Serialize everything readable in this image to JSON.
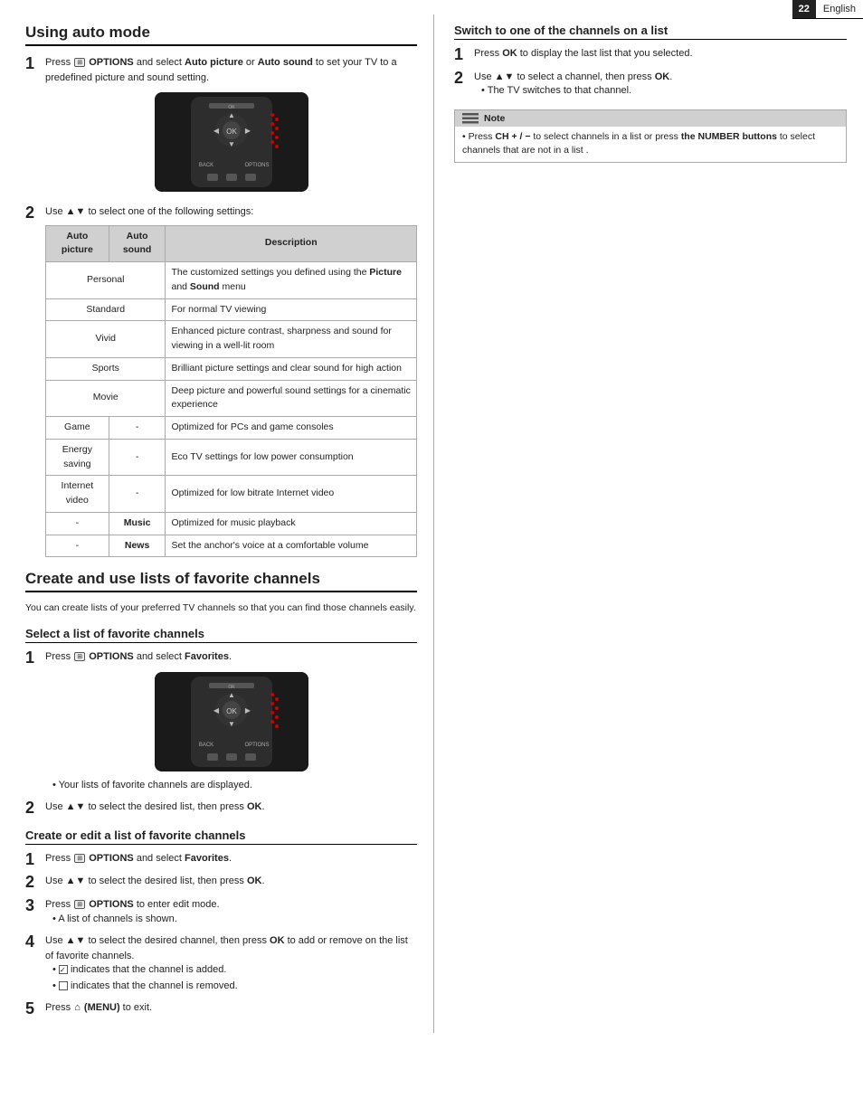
{
  "page": {
    "number": "22",
    "language": "English"
  },
  "left_column": {
    "section1": {
      "title": "Using auto mode",
      "step1": {
        "num": "1",
        "text_before": "Press ",
        "icon": "OPTIONS",
        "text_after": " OPTIONS and select ",
        "bold1": "Auto picture",
        "text_mid": " or ",
        "bold2": "Auto sound",
        "text_end": " to set your TV to a predefined picture and sound setting."
      },
      "step2": {
        "num": "2",
        "text": "Use ▲▼ to select one of the following settings:"
      },
      "table": {
        "headers": [
          "Auto picture",
          "Auto sound",
          "Description"
        ],
        "rows": [
          {
            "col1": "Personal",
            "col2": "",
            "merged12": true,
            "col3": "The customized settings you defined using the Picture and Sound menu"
          },
          {
            "col1": "Standard",
            "col2": "",
            "merged12": true,
            "col3": "For normal TV viewing"
          },
          {
            "col1": "Vivid",
            "col2": "",
            "merged12": true,
            "col3": "Enhanced picture contrast, sharpness and sound for viewing in a well-lit room"
          },
          {
            "col1": "Sports",
            "col2": "",
            "merged12": true,
            "col3": "Brilliant picture settings and clear sound for high action"
          },
          {
            "col1": "Movie",
            "col2": "",
            "merged12": true,
            "col3": "Deep picture and powerful sound settings for a cinematic experience"
          },
          {
            "col1": "Game",
            "col2": "-",
            "merged12": false,
            "col3": "Optimized for PCs and game consoles"
          },
          {
            "col1": "Energy saving",
            "col2": "-",
            "merged12": false,
            "col3": "Eco TV settings for low power consumption"
          },
          {
            "col1": "Internet video",
            "col2": "-",
            "merged12": false,
            "col3": "Optimized for low bitrate Internet video"
          },
          {
            "col1": "-",
            "col2": "Music",
            "merged12": false,
            "col3": "Optimized for music playback"
          },
          {
            "col1": "-",
            "col2": "News",
            "merged12": false,
            "col3": "Set the anchor's voice at a comfortable volume"
          }
        ]
      }
    },
    "section2": {
      "title": "Create and use lists of favorite channels",
      "intro": "You can create lists of your preferred TV channels so that you can find those channels easily.",
      "subsection1": {
        "title": "Select a list of favorite channels",
        "step1": {
          "num": "1",
          "text_before": "Press ",
          "icon": "OPTIONS",
          "text_bold": "OPTIONS",
          "text_after": " and select ",
          "bold_end": "Favorites",
          "text_dot": "."
        },
        "bullet1": "Your lists of favorite channels are displayed.",
        "step2": {
          "num": "2",
          "text_before": "Use ▲▼ to select the desired list, then press ",
          "bold": "OK",
          "text_end": "."
        }
      },
      "subsection2": {
        "title": "Create or edit a list of favorite channels",
        "step1": {
          "num": "1",
          "text_before": "Press ",
          "icon": "OPTIONS",
          "text_bold": "OPTIONS",
          "text_after": " and select ",
          "bold_end": "Favorites",
          "text_dot": "."
        },
        "step2": {
          "num": "2",
          "text_before": "Use ▲▼ to select the desired list, then press ",
          "bold": "OK",
          "text_end": "."
        },
        "step3": {
          "num": "3",
          "text_before": "Press ",
          "icon": "OPTIONS",
          "text_bold": "OPTIONS",
          "text_after": " to enter edit mode."
        },
        "bullet_step3": "A list of channels is shown.",
        "step4": {
          "num": "4",
          "text_before": "Use ▲▼ to select the desired channel, then press ",
          "bold": "OK",
          "text_after": " to add or remove on the list of favorite channels."
        },
        "bullets_step4": [
          "☑ indicates that the channel is added.",
          "☐ indicates that the channel is removed."
        ],
        "step5": {
          "num": "5",
          "text_before": "Press ",
          "icon": "HOME",
          "text_bold": "(MENU)",
          "text_after": " to exit."
        }
      }
    }
  },
  "right_column": {
    "section": {
      "title": "Switch to one of the channels on a list",
      "step1": {
        "num": "1",
        "text_before": "Press ",
        "bold": "OK",
        "text_after": " to display the last list that you selected."
      },
      "step2": {
        "num": "2",
        "text_before": "Use ▲▼ to select a channel, then press ",
        "bold": "OK",
        "text_end": "."
      },
      "bullet_step2": "The TV switches to that channel.",
      "note": {
        "header": "Note",
        "items": [
          "Press CH + / − to select channels in a list or press the NUMBER buttons to select channels that are not in a list ."
        ]
      }
    }
  }
}
